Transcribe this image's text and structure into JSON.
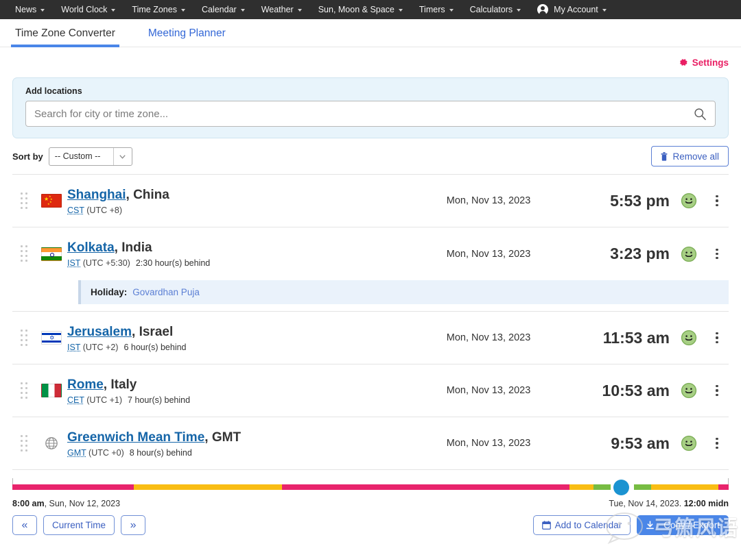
{
  "topnav": {
    "items": [
      {
        "label": "News",
        "caret": true
      },
      {
        "label": "World Clock",
        "caret": true
      },
      {
        "label": "Time Zones",
        "caret": true
      },
      {
        "label": "Calendar",
        "caret": true
      },
      {
        "label": "Weather",
        "caret": true
      },
      {
        "label": "Sun, Moon & Space",
        "caret": true
      },
      {
        "label": "Timers",
        "caret": true
      },
      {
        "label": "Calculators",
        "caret": true
      },
      {
        "label": "My Account",
        "caret": true
      }
    ]
  },
  "tabs": [
    {
      "label": "Time Zone Converter",
      "active": true
    },
    {
      "label": "Meeting Planner",
      "active": false
    }
  ],
  "settings": {
    "label": "Settings",
    "icon": "gear-icon",
    "color": "#e91e63"
  },
  "search": {
    "label": "Add locations",
    "placeholder": "Search for city or time zone...",
    "value": "",
    "icon": "search-icon"
  },
  "sort": {
    "label": "Sort by",
    "selected": "-- Custom --",
    "options": [
      "-- Custom --"
    ]
  },
  "remove_all": {
    "label": "Remove all",
    "icon": "trash-icon"
  },
  "locations": [
    {
      "city": "Shanghai",
      "country": "China",
      "flag": "cn",
      "tz_abbr": "CST",
      "utc_offset": "(UTC +8)",
      "offset_note": "",
      "date": "Mon, Nov 13, 2023",
      "time": "5:53 pm",
      "status_icon": "smiley-icon",
      "holiday": null
    },
    {
      "city": "Kolkata",
      "country": "India",
      "flag": "in",
      "tz_abbr": "IST",
      "utc_offset": "(UTC +5:30)",
      "offset_note": "2:30 hour(s) behind",
      "date": "Mon, Nov 13, 2023",
      "time": "3:23 pm",
      "status_icon": "smiley-icon",
      "holiday": {
        "label": "Holiday:",
        "name": "Govardhan Puja"
      }
    },
    {
      "city": "Jerusalem",
      "country": "Israel",
      "flag": "il",
      "tz_abbr": "IST",
      "utc_offset": "(UTC +2)",
      "offset_note": "6 hour(s) behind",
      "date": "Mon, Nov 13, 2023",
      "time": "11:53 am",
      "status_icon": "smiley-icon",
      "holiday": null
    },
    {
      "city": "Rome",
      "country": "Italy",
      "flag": "it",
      "tz_abbr": "CET",
      "utc_offset": "(UTC +1)",
      "offset_note": "7 hour(s) behind",
      "date": "Mon, Nov 13, 2023",
      "time": "10:53 am",
      "status_icon": "smiley-icon",
      "holiday": null
    },
    {
      "city": "Greenwich Mean Time",
      "country": "GMT",
      "flag": "globe",
      "tz_abbr": "GMT",
      "utc_offset": "(UTC +0)",
      "offset_note": "8 hour(s) behind",
      "date": "Mon, Nov 13, 2023",
      "time": "9:53 am",
      "status_icon": "smiley-icon",
      "holiday": null
    }
  ],
  "timeline": {
    "start_time": "8:00 am",
    "start_date": ", Sun, Nov 12, 2023",
    "end_date": "Tue, Nov 14, 2023. ",
    "end_time": "12:00 midn",
    "knob_position_pct": 85.0,
    "colors": {
      "night": "#e8246c",
      "evening": "#f9bd14",
      "day": "#77bc43",
      "knob": "#1b93d1"
    },
    "segments": [
      {
        "color": "#e8246c",
        "start_pct": 0.0,
        "end_pct": 17.0
      },
      {
        "color": "#f9bd14",
        "start_pct": 17.0,
        "end_pct": 37.6
      },
      {
        "color": "#e8246c",
        "start_pct": 37.6,
        "end_pct": 77.8
      },
      {
        "color": "#f9bd14",
        "start_pct": 77.8,
        "end_pct": 81.1
      },
      {
        "color": "#77bc43",
        "start_pct": 81.1,
        "end_pct": 83.5
      },
      {
        "color": "#77bc43",
        "start_pct": 86.8,
        "end_pct": 89.2
      },
      {
        "color": "#f9bd14",
        "start_pct": 89.2,
        "end_pct": 98.6
      },
      {
        "color": "#e8246c",
        "start_pct": 98.6,
        "end_pct": 100.0
      }
    ]
  },
  "bottom_buttons": {
    "prev": "«",
    "current_time": "Current Time",
    "next": "»",
    "add_to_calendar": "Add to Calendar",
    "copy_export": "Copy / Export"
  },
  "watermark": {
    "text": "弓箫风语",
    "icon": "wechat-bubble-icon"
  }
}
